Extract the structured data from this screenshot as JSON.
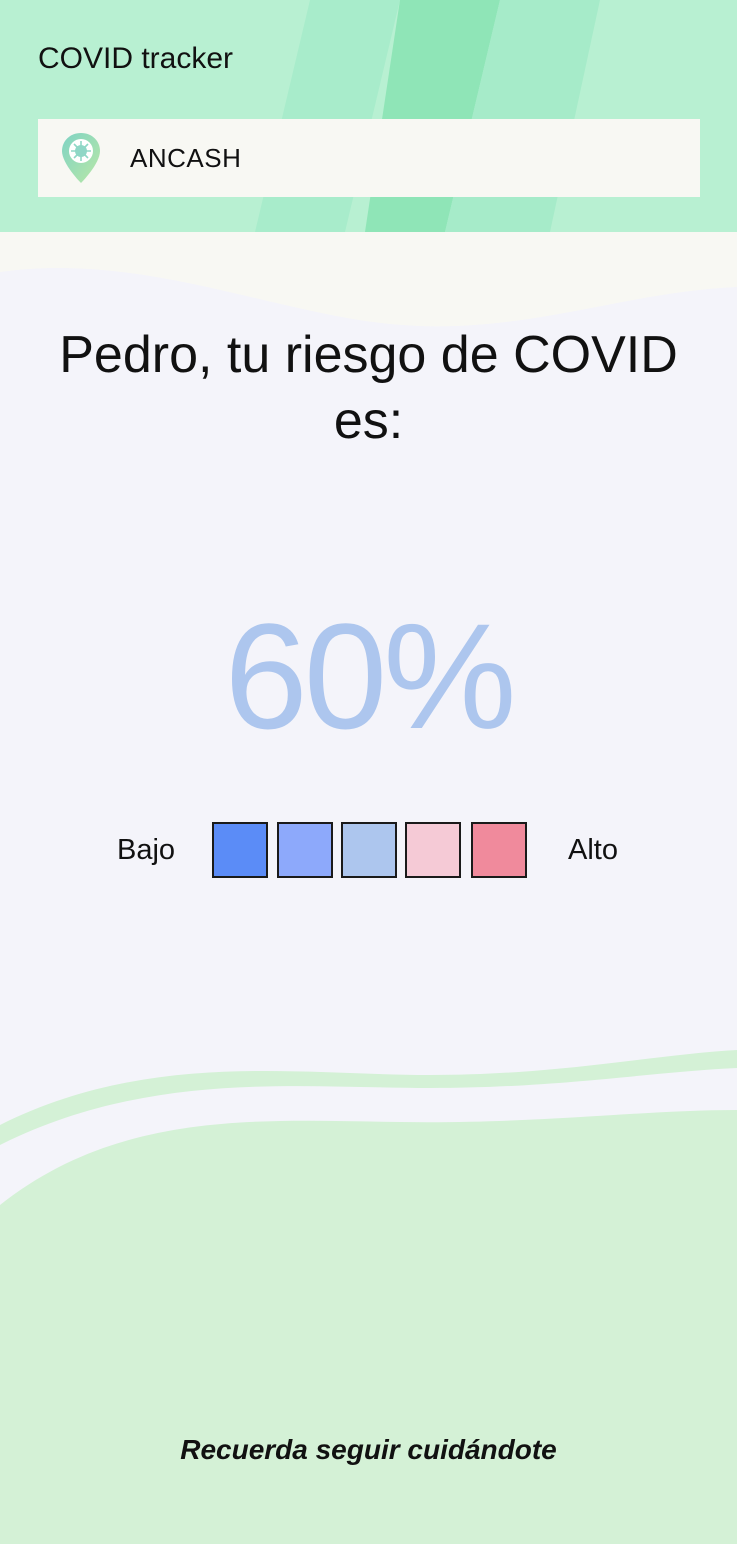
{
  "app": {
    "title": "COVID tracker"
  },
  "location": {
    "name": "ANCASH",
    "icon": "location-pin-icon"
  },
  "risk": {
    "heading": "Pedro, tu riesgo de COVID es:",
    "percent_text": "60%",
    "percent_value": 60
  },
  "scale": {
    "low_label": "Bajo",
    "high_label": "Alto",
    "colors": [
      "#5b8cf7",
      "#8da9fb",
      "#adc6ee",
      "#f5cad6",
      "#f08a9c"
    ]
  },
  "footer": {
    "message": "Recuerda seguir cuidándote"
  },
  "theme": {
    "header_bg": "#b8f0d2",
    "body_bg": "#f4f4fa",
    "bottom_bg": "#d4f1d6",
    "percent_color": "#adc6ee"
  }
}
